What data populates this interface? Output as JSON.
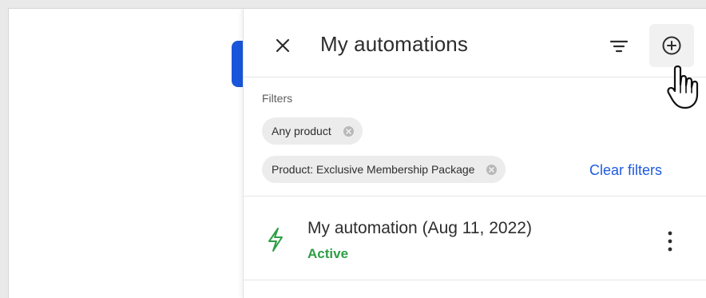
{
  "panel": {
    "title": "My automations",
    "icons": {
      "close": "close-icon",
      "filter": "filter-icon",
      "add": "add-circle-icon",
      "cursor": "hand-pointer-cursor"
    }
  },
  "filters": {
    "label": "Filters",
    "chips": [
      {
        "label": "Any product"
      },
      {
        "label": "Product: Exclusive Membership Package"
      }
    ],
    "clear_label": "Clear filters"
  },
  "automations": [
    {
      "name": "My automation (Aug 11, 2022)",
      "status": "Active",
      "icon": "lightning-bolt-icon"
    }
  ],
  "colors": {
    "accent_blue": "#1f5ae0",
    "side_tab_blue": "#1a56db",
    "status_green": "#2e9e45"
  }
}
